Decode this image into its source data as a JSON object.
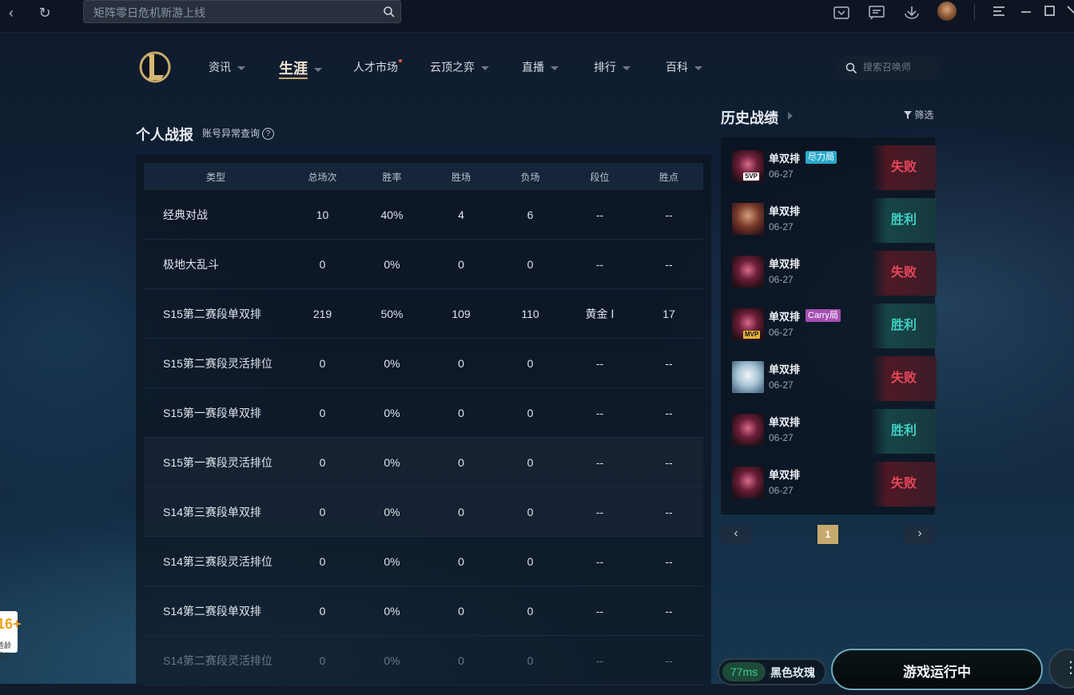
{
  "topbar": {
    "search_placeholder": "矩阵零日危机新游上线",
    "icons": [
      "back-icon",
      "refresh-icon",
      "search-icon",
      "inbox-icon",
      "message-icon",
      "download-icon",
      "menu-icon",
      "minimize-icon",
      "maximize-icon",
      "close-icon"
    ]
  },
  "nav": {
    "items": [
      {
        "label": "资讯"
      },
      {
        "label": "生涯"
      },
      {
        "label": "人才市场"
      },
      {
        "label": "云顶之弈"
      },
      {
        "label": "直播"
      },
      {
        "label": "排行"
      },
      {
        "label": "百科"
      }
    ],
    "active": "生涯",
    "summoner_search_placeholder": "搜索召唤师"
  },
  "stats": {
    "title": "个人战报",
    "account_check": "账号异常查询",
    "help_icon": "?",
    "columns": [
      "类型",
      "总场次",
      "胜率",
      "胜场",
      "负场",
      "段位",
      "胜点"
    ],
    "rows": [
      [
        "经典对战",
        "10",
        "40%",
        "4",
        "6",
        "--",
        "--"
      ],
      [
        "极地大乱斗",
        "0",
        "0%",
        "0",
        "0",
        "--",
        "--"
      ],
      [
        "S15第二赛段单双排",
        "219",
        "50%",
        "109",
        "110",
        "黄金 Ⅰ",
        "17"
      ],
      [
        "S15第二赛段灵活排位",
        "0",
        "0%",
        "0",
        "0",
        "--",
        "--"
      ],
      [
        "S15第一赛段单双排",
        "0",
        "0%",
        "0",
        "0",
        "--",
        "--"
      ],
      [
        "S15第一赛段灵活排位",
        "0",
        "0%",
        "0",
        "0",
        "--",
        "--"
      ],
      [
        "S14第三赛段单双排",
        "0",
        "0%",
        "0",
        "0",
        "--",
        "--"
      ],
      [
        "S14第三赛段灵活排位",
        "0",
        "0%",
        "0",
        "0",
        "--",
        "--"
      ],
      [
        "S14第二赛段单双排",
        "0",
        "0%",
        "0",
        "0",
        "--",
        "--"
      ],
      [
        "S14第二赛段灵活排位",
        "0",
        "0%",
        "0",
        "0",
        "--",
        "--"
      ]
    ]
  },
  "history": {
    "title": "历史战绩",
    "filter": "筛选",
    "matches": [
      {
        "queue": "单双排",
        "date": "06-27",
        "result": "失败",
        "tag": "尽力局",
        "badge": "SVP",
        "champ": "c1"
      },
      {
        "queue": "单双排",
        "date": "06-27",
        "result": "胜利",
        "tag": "",
        "badge": "",
        "champ": "c2"
      },
      {
        "queue": "单双排",
        "date": "06-27",
        "result": "失败",
        "tag": "",
        "badge": "",
        "champ": "c1"
      },
      {
        "queue": "单双排",
        "date": "06-27",
        "result": "胜利",
        "tag": "Carry局",
        "badge": "MVP",
        "champ": "c1"
      },
      {
        "queue": "单双排",
        "date": "06-27",
        "result": "失败",
        "tag": "",
        "badge": "",
        "champ": "c3"
      },
      {
        "queue": "单双排",
        "date": "06-27",
        "result": "胜利",
        "tag": "",
        "badge": "",
        "champ": "c1"
      },
      {
        "queue": "单双排",
        "date": "06-27",
        "result": "失败",
        "tag": "",
        "badge": "",
        "champ": "c1"
      }
    ],
    "page": "1",
    "prev": "‹",
    "next": "›"
  },
  "footer": {
    "ping": "77ms",
    "champion": "黑色玫瑰",
    "game_status": "游戏运行中",
    "age_badge": "16+",
    "age_text": "适龄提示"
  },
  "colors": {
    "accent_gold": "#c8aa6e",
    "win": "#3fd1c2",
    "loss": "#e8475a"
  }
}
